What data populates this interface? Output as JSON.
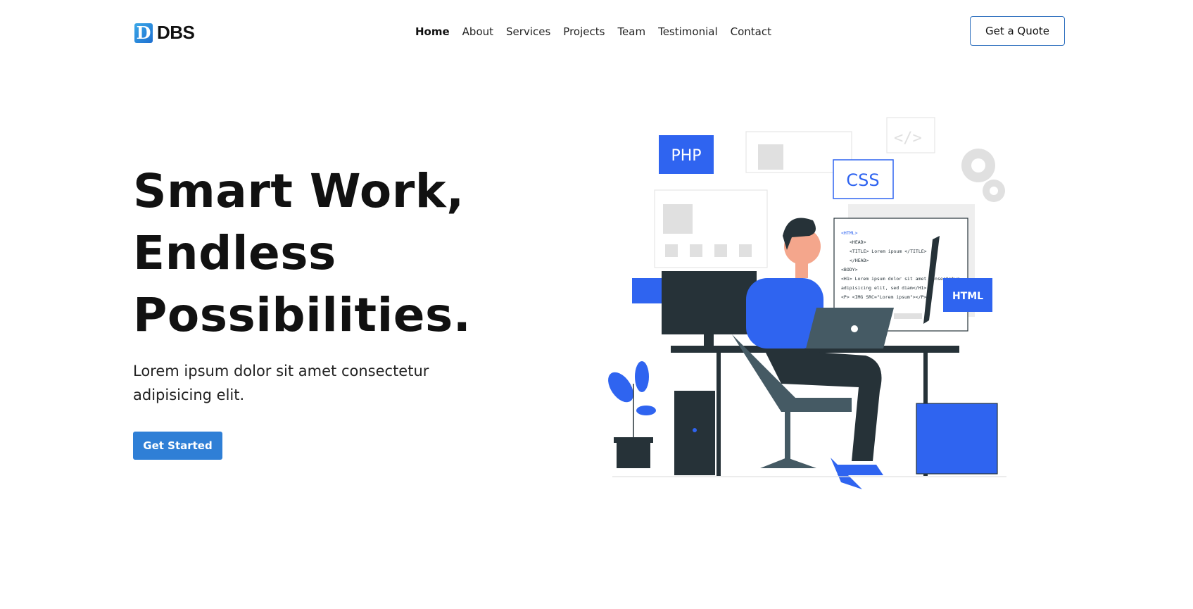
{
  "brand": {
    "logo_letter": "D",
    "name": "DBS"
  },
  "nav": {
    "items": [
      {
        "label": "Home",
        "active": true
      },
      {
        "label": "About"
      },
      {
        "label": "Services"
      },
      {
        "label": "Projects"
      },
      {
        "label": "Team"
      },
      {
        "label": "Testimonial"
      },
      {
        "label": "Contact"
      }
    ]
  },
  "header": {
    "quote_label": "Get a Quote"
  },
  "hero": {
    "title_line1": "Smart Work,",
    "title_line2": "Endless",
    "title_line3": "Possibilities.",
    "subtitle": "Lorem ipsum dolor sit amet consectetur adipisicing elit.",
    "cta_label": "Get Started"
  },
  "illustration": {
    "tag_php": "PHP",
    "tag_css": "CSS",
    "tag_html": "HTML",
    "code_lines": [
      "<HTML>",
      "<HEAD>",
      "<TITLE> Lorem ipsum </TITLE>",
      "</HEAD>",
      "<BODY>",
      "<H1> Lorem ipsum dolor sit amet consectetur",
      "adipisicing elit, sed diam</H1>",
      "<P> <IMG SRC=\"Lorem ipsum\"></P>"
    ],
    "colors": {
      "accent_blue": "#2f64f0",
      "dark": "#263238",
      "gray": "#e0e0e0"
    }
  }
}
